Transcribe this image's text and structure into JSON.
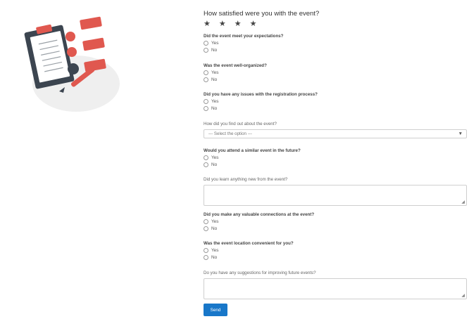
{
  "illustration": {
    "alt": "survey clipboard illustration"
  },
  "rating": {
    "question": "How satisfied were you with the event?",
    "stars": [
      "★",
      "★",
      "★",
      "★"
    ]
  },
  "questions": [
    {
      "label": "Did the event meet your expectations?",
      "options": [
        "Yes",
        "No"
      ]
    },
    {
      "label": "Was the event well-organized?",
      "options": [
        "Yes",
        "No"
      ]
    },
    {
      "label": "Did you have any issues with the registration process?",
      "options": [
        "Yes",
        "No"
      ]
    }
  ],
  "source_question": {
    "label": "How did you find out about the event?",
    "selected": "--- Select the option ---"
  },
  "attend_again": {
    "label": "Would you attend a similar event in the future?",
    "options": [
      "Yes",
      "No"
    ]
  },
  "learn_new": {
    "label": "Did you learn anything new from the event?"
  },
  "connections": {
    "label": "Did you make any valuable connections at the event?",
    "options": [
      "Yes",
      "No"
    ]
  },
  "location": {
    "label": "Was the event location convenient for you?",
    "options": [
      "Yes",
      "No"
    ]
  },
  "suggestions": {
    "label": "Do you have any suggestions for improving future events?"
  },
  "submit": {
    "label": "Send"
  }
}
